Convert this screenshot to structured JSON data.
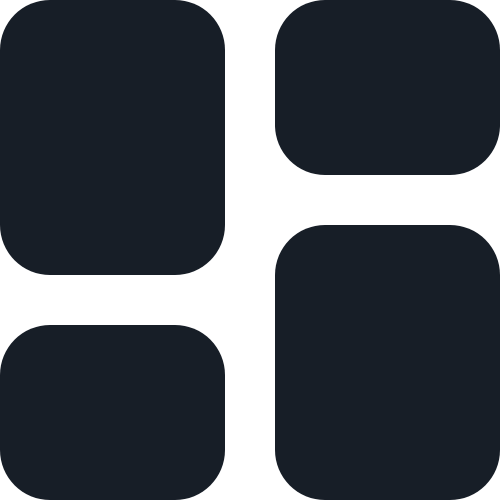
{
  "icon": {
    "name": "dashboard-layout-icon",
    "color": "#171e27",
    "background": "#ffffff"
  }
}
